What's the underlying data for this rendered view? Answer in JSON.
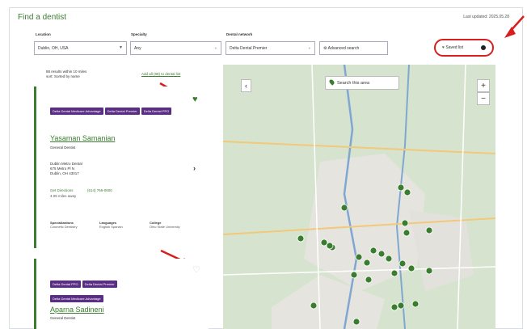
{
  "header": {
    "title": "Find a dentist",
    "updated": "Last updated: 2025.05.28"
  },
  "filters": {
    "location_label": "Location",
    "location_value": "Dublin, OH, USA",
    "specialty_label": "Specialty",
    "specialty_value": "Any",
    "network_label": "Dental network",
    "network_value": "Delta Dental Premier",
    "advanced_label": "Advanced search",
    "saved_label": "Saved list"
  },
  "results": {
    "count_text": "88 results within 10 miles",
    "sort_text": "sort: Sorted by name",
    "add_all": "Add all (88) to dental list"
  },
  "cards": [
    {
      "tags": [
        "Delta Dental Medicare Advantage",
        "Delta Dental Premier",
        "Delta Dental PPO"
      ],
      "name": "Yasaman Samanian",
      "role": "General Dentist",
      "address": [
        "Dublin Metro Dental",
        "675 Metro Pl N",
        "Dublin, OH 43017"
      ],
      "directions": "Get Directions",
      "phone": "(614) 766-0600",
      "distance": "4.06 miles away",
      "info": [
        {
          "label": "Specializations",
          "value": "Cosmetic Dentistry"
        },
        {
          "label": "Languages",
          "value": "English Spanish"
        },
        {
          "label": "College",
          "value": "Ohio State University"
        }
      ]
    },
    {
      "tags": [
        "Delta Dental PPO",
        "Delta Dental Premier",
        "Delta Dental Medicare Advantage"
      ],
      "name": "Aparna Sadineni",
      "role": "General Dentist"
    }
  ],
  "map": {
    "search_area": "Search this area",
    "zoom_in": "+",
    "zoom_out": "−",
    "collapse": "‹"
  },
  "colors": {
    "brand_green": "#3a7d2f",
    "tag_purple": "#5b2e86",
    "highlight_red": "#d91e1e"
  }
}
